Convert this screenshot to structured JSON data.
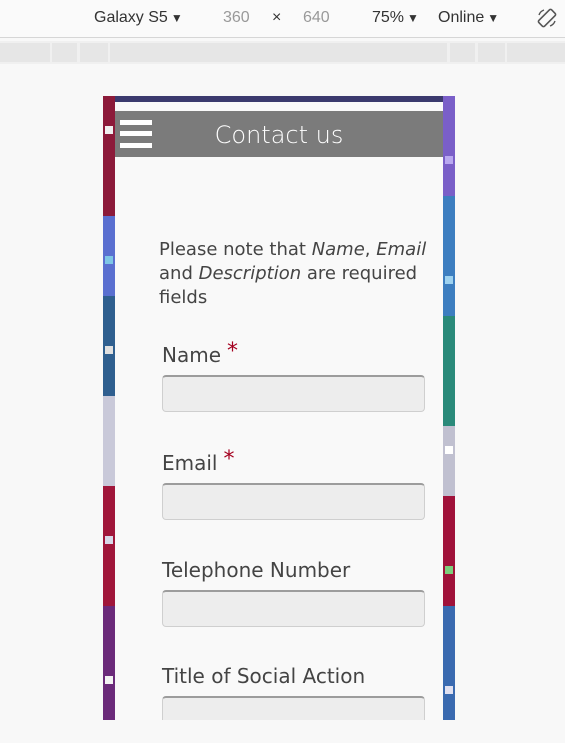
{
  "devtools": {
    "device": "Galaxy S5",
    "width": "360",
    "times": "×",
    "height": "640",
    "zoom": "75%",
    "network": "Online",
    "caret": "▼"
  },
  "header": {
    "title": "Contact us"
  },
  "note": {
    "prefix": "Please note that ",
    "name": "Name",
    "comma": ", ",
    "email": "Email",
    "and": " and ",
    "description": "Description",
    "suffix": " are required fields"
  },
  "form": {
    "required_mark": "*",
    "fields": [
      {
        "label": "Name",
        "value": ""
      },
      {
        "label": "Email",
        "value": ""
      },
      {
        "label": "Telephone Number",
        "value": ""
      },
      {
        "label": "Title of Social Action",
        "value": ""
      }
    ]
  },
  "colors": {
    "header": "#7b7b7b",
    "required": "#a4001f",
    "input_bg": "#ededed"
  }
}
